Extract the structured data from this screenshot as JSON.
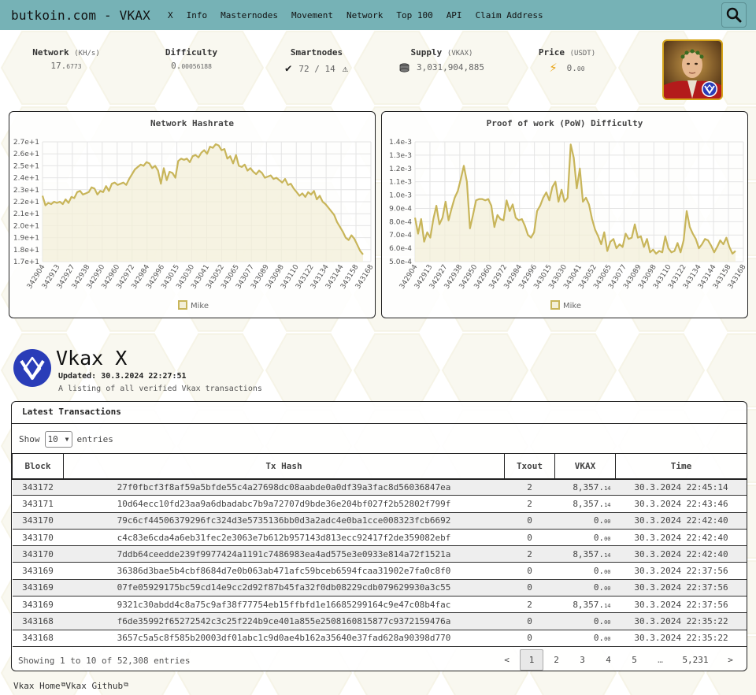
{
  "nav": {
    "brand": "butkoin.com - VKAX",
    "items": [
      "X",
      "Info",
      "Masternodes",
      "Movement",
      "Network",
      "Top 100",
      "API",
      "Claim Address"
    ]
  },
  "stats": {
    "network": {
      "label": "Network",
      "unit": "(KH/s)",
      "value_main": "17.",
      "value_small": "6773"
    },
    "difficulty": {
      "label": "Difficulty",
      "value_main": "0.",
      "value_small": "00056188"
    },
    "smartnodes": {
      "label": "Smartnodes",
      "value": "72 / 14"
    },
    "supply": {
      "label": "Supply",
      "unit": "(VKAX)",
      "value": "3,031,904,885"
    },
    "price": {
      "label": "Price",
      "unit": "(USDT)",
      "value_main": "0.",
      "value_small": "00"
    }
  },
  "chart_data": [
    {
      "type": "area",
      "title": "Network Hashrate",
      "legend": [
        "Mike"
      ],
      "legend_position": "bottom",
      "grid": true,
      "ylim": [
        17,
        27
      ],
      "yticks": [
        "1.7e+1",
        "1.8e+1",
        "1.9e+1",
        "2.0e+1",
        "2.1e+1",
        "2.2e+1",
        "2.3e+1",
        "2.4e+1",
        "2.5e+1",
        "2.6e+1",
        "2.7e+1"
      ],
      "xticks": [
        "342904",
        "342913",
        "342927",
        "342938",
        "342950",
        "342960",
        "342972",
        "342984",
        "342996",
        "343015",
        "343030",
        "343041",
        "343052",
        "343065",
        "343077",
        "343089",
        "343098",
        "343110",
        "343122",
        "343134",
        "343144",
        "343158",
        "343168"
      ],
      "values": [
        22.5,
        21.7,
        21.9,
        21.8,
        22.0,
        21.9,
        22.0,
        21.8,
        22.2,
        21.9,
        22.4,
        22.3,
        22.8,
        22.9,
        22.6,
        22.7,
        22.8,
        23.2,
        23.1,
        22.6,
        22.9,
        22.8,
        23.3,
        22.9,
        23.5,
        23.6,
        23.4,
        23.5,
        23.6,
        23.4,
        23.9,
        24.3,
        24.7,
        24.9,
        25.1,
        25.0,
        25.3,
        25.2,
        24.8,
        25.0,
        24.6,
        23.5,
        24.8,
        23.8,
        24.5,
        24.4,
        24.0,
        25.4,
        25.6,
        25.5,
        25.6,
        25.3,
        25.8,
        25.9,
        25.7,
        26.1,
        26.3,
        26.0,
        26.6,
        26.5,
        26.8,
        26.7,
        26.3,
        26.4,
        25.6,
        25.8,
        25.2,
        25.9,
        25.0,
        24.9,
        25.1,
        24.6,
        24.8,
        24.5,
        24.3,
        24.6,
        24.4,
        24.0,
        24.1,
        24.2,
        23.9,
        24.0,
        23.8,
        23.6,
        23.9,
        23.4,
        23.5,
        23.1,
        22.8,
        22.5,
        22.7,
        22.4,
        22.8,
        22.6,
        22.9,
        22.2,
        22.5,
        22.0,
        21.8,
        21.5,
        21.2,
        20.9,
        20.3,
        19.9,
        19.5,
        19.0,
        18.8,
        19.2,
        18.9,
        18.4,
        17.9,
        17.6
      ]
    },
    {
      "type": "area",
      "title": "Proof of work (PoW) Difficulty",
      "legend": [
        "Mike"
      ],
      "legend_position": "bottom",
      "grid": true,
      "ylim": [
        0.0005,
        0.0014
      ],
      "yticks": [
        "5.0e-4",
        "6.0e-4",
        "7.0e-4",
        "8.0e-4",
        "9.0e-4",
        "1.0e-3",
        "1.1e-3",
        "1.2e-3",
        "1.3e-3",
        "1.4e-3"
      ],
      "xticks": [
        "342904",
        "342913",
        "342927",
        "342938",
        "342950",
        "342960",
        "342972",
        "342984",
        "342996",
        "343015",
        "343030",
        "343041",
        "343052",
        "343065",
        "343077",
        "343089",
        "343098",
        "343110",
        "343122",
        "343134",
        "343144",
        "343158",
        "343168"
      ],
      "values": [
        0.00083,
        0.00071,
        0.00082,
        0.00065,
        0.00072,
        0.00068,
        0.00082,
        0.00092,
        0.00078,
        0.00083,
        0.00095,
        0.00081,
        0.0009,
        0.00098,
        0.00103,
        0.00112,
        0.00122,
        0.0011,
        0.00075,
        0.00085,
        0.00096,
        0.00097,
        0.00097,
        0.00096,
        0.00097,
        0.00092,
        0.00076,
        0.00085,
        0.00082,
        0.00081,
        0.00096,
        0.00088,
        0.00093,
        0.00083,
        0.00081,
        0.00082,
        0.00077,
        0.0007,
        0.00068,
        0.00072,
        0.00088,
        0.00092,
        0.00098,
        0.00102,
        0.00096,
        0.00106,
        0.0011,
        0.00095,
        0.00104,
        0.00095,
        0.00098,
        0.00138,
        0.00128,
        0.00105,
        0.0012,
        0.00095,
        0.00098,
        0.00093,
        0.00082,
        0.00074,
        0.00069,
        0.00063,
        0.00072,
        0.00058,
        0.00065,
        0.00067,
        0.0006,
        0.00063,
        0.00061,
        0.00071,
        0.00067,
        0.00068,
        0.00078,
        0.00068,
        0.00069,
        0.00061,
        0.00067,
        0.00057,
        0.00059,
        0.00056,
        0.00058,
        0.00057,
        0.00069,
        0.0006,
        0.00057,
        0.00058,
        0.00064,
        0.00057,
        0.00066,
        0.00088,
        0.00076,
        0.00071,
        0.00067,
        0.0006,
        0.00063,
        0.00067,
        0.00066,
        0.00062,
        0.00057,
        0.00061,
        0.00066,
        0.00063,
        0.00068,
        0.00061,
        0.00056,
        0.00058
      ]
    }
  ],
  "explorer": {
    "title": "Vkax X",
    "updated_label": "Updated:",
    "updated_value": "30.3.2024 22:27:51",
    "description": "A listing of all verified Vkax transactions"
  },
  "transactions": {
    "header": "Latest Transactions",
    "show_label": "Show",
    "page_size": "10",
    "entries_label": "entries",
    "columns": [
      "Block",
      "Tx Hash",
      "Txout",
      "VKAX",
      "Time"
    ],
    "rows": [
      {
        "block": "343172",
        "hash": "27f0fbcf3f8af59a5bfde55c4a27698dc08aabde0a0df39a3fac8d56036847ea",
        "txout": "2",
        "vkax_main": "8,357.",
        "vkax_small": "14",
        "time": "30.3.2024 22:45:14"
      },
      {
        "block": "343171",
        "hash": "10d64ecc10fd23aa9a6dbadabc7b9a72707d9bde36e204bf027f2b52802f799f",
        "txout": "2",
        "vkax_main": "8,357.",
        "vkax_small": "14",
        "time": "30.3.2024 22:43:46"
      },
      {
        "block": "343170",
        "hash": "79c6cf44506379296fc324d3e5735136bb0d3a2adc4e0ba1cce008323fcb6692",
        "txout": "0",
        "vkax_main": "0.",
        "vkax_small": "00",
        "time": "30.3.2024 22:42:40"
      },
      {
        "block": "343170",
        "hash": "c4c83e6cda4a6eb31fec2e3063e7b612b957143d813ecc92417f2de359082ebf",
        "txout": "0",
        "vkax_main": "0.",
        "vkax_small": "00",
        "time": "30.3.2024 22:42:40"
      },
      {
        "block": "343170",
        "hash": "7ddb64ceedde239f9977424a1191c7486983ea4ad575e3e0933e814a72f1521a",
        "txout": "2",
        "vkax_main": "8,357.",
        "vkax_small": "14",
        "time": "30.3.2024 22:42:40"
      },
      {
        "block": "343169",
        "hash": "36386d3bae5b4cbf8684d7e0b063ab471afc59bceb6594fcaa31902e7fa0c8f0",
        "txout": "0",
        "vkax_main": "0.",
        "vkax_small": "00",
        "time": "30.3.2024 22:37:56"
      },
      {
        "block": "343169",
        "hash": "07fe05929175bc59cd14e9cc2d92f87b45fa32f0db08229cdb079629930a3c55",
        "txout": "0",
        "vkax_main": "0.",
        "vkax_small": "00",
        "time": "30.3.2024 22:37:56"
      },
      {
        "block": "343169",
        "hash": "9321c30abdd4c8a75c9af38f77754eb15ffbfd1e16685299164c9e47c08b4fac",
        "txout": "2",
        "vkax_main": "8,357.",
        "vkax_small": "14",
        "time": "30.3.2024 22:37:56"
      },
      {
        "block": "343168",
        "hash": "f6de35992f65272542c3c25f224b9ce401a855e2508160815877c9372159476a",
        "txout": "0",
        "vkax_main": "0.",
        "vkax_small": "00",
        "time": "30.3.2024 22:35:22"
      },
      {
        "block": "343168",
        "hash": "3657c5a5c8f585b20003df01abc1c9d0ae4b162a35640e37fad628a90398d770",
        "txout": "0",
        "vkax_main": "0.",
        "vkax_small": "00",
        "time": "30.3.2024 22:35:22"
      }
    ],
    "summary": "Showing 1 to 10 of 52,308 entries",
    "pages": [
      "<",
      "1",
      "2",
      "3",
      "4",
      "5",
      "…",
      "5,231",
      ">"
    ],
    "active_page": "1"
  },
  "footer": {
    "links": [
      "Vkax Home",
      "Vkax Github"
    ]
  },
  "colors": {
    "navbar": "#76b2b6",
    "chart_line": "#c8b55a",
    "chart_fill": "#f3efd8",
    "logo_blue": "#2a3db8"
  },
  "icons": {
    "search": "search-icon",
    "smartnodes_ok": "checkmark-icon",
    "smartnodes_warn": "warning-icon",
    "supply": "coins-icon",
    "price": "lightning-icon",
    "external_link": "external-link-icon"
  }
}
